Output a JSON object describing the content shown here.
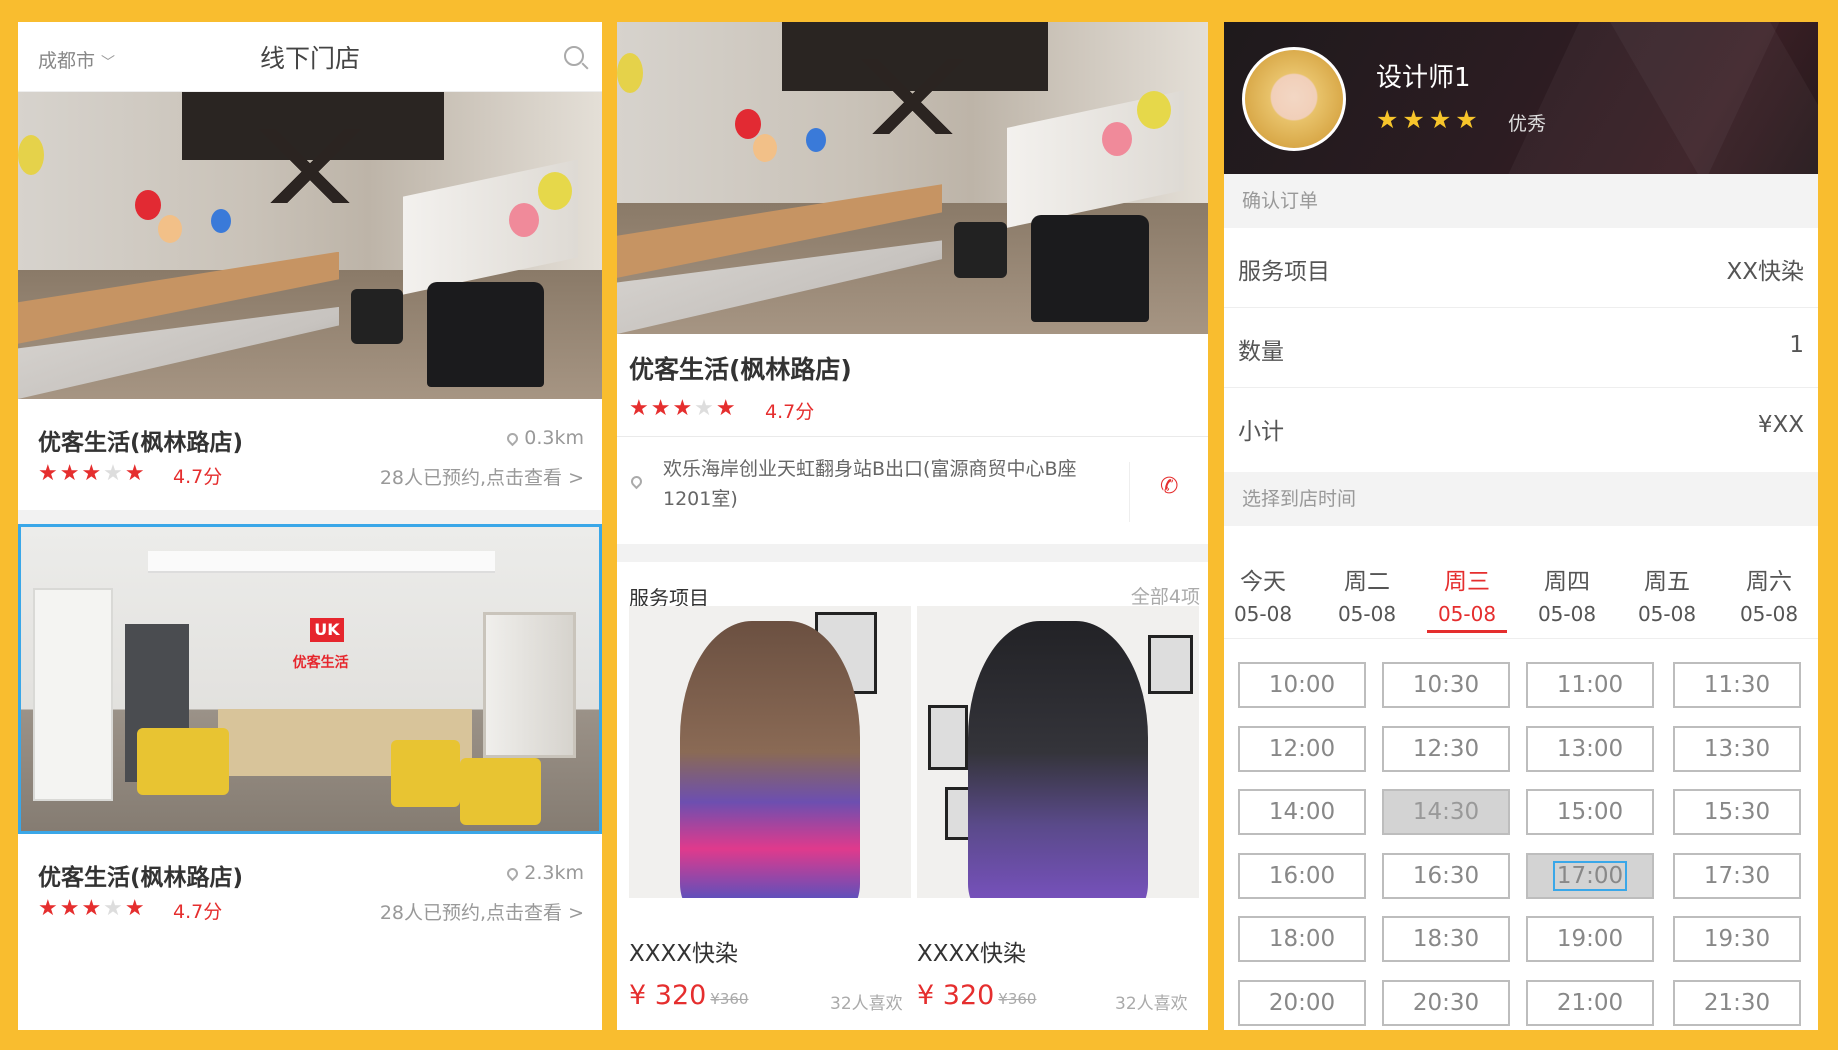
{
  "colors": {
    "background": "#f9bd2f",
    "accent_red": "#e52e2e",
    "star_gold": "#f7c52b",
    "selection_blue": "#3aa7e8"
  },
  "panel1": {
    "city": "成都市",
    "title": "线下门店",
    "stores": [
      {
        "name": "优客生活(枫林路店)",
        "distance": "0.3km",
        "score": "4.7分",
        "booked": "28人已预约,点击查看 >"
      },
      {
        "name": "优客生活(枫林路店)",
        "distance": "2.3km",
        "score": "4.7分",
        "booked": "28人已预约,点击查看 >"
      }
    ],
    "salon_logo": "UK",
    "salon_logo_text": "优客生活"
  },
  "panel2": {
    "store_name": "优客生活(枫林路店)",
    "score": "4.7分",
    "address": "欢乐海岸创业天虹翻身站B出口(富源商贸中心B座1201室)",
    "services_title": "服务项目",
    "services_all": "全部4项",
    "services": [
      {
        "name": "XXXX快染",
        "price": "¥ 320",
        "original_price": "¥360",
        "likes": "32人喜欢"
      },
      {
        "name": "XXXX快染",
        "price": "¥ 320",
        "original_price": "¥360",
        "likes": "32人喜欢"
      }
    ]
  },
  "panel3": {
    "designer_name": "设计师1",
    "rating_word": "优秀",
    "confirm_title": "确认订单",
    "rows": [
      {
        "label": "服务项目",
        "value": "XX快染"
      },
      {
        "label": "数量",
        "value": "1"
      },
      {
        "label": "小计",
        "value": "¥XX"
      }
    ],
    "select_time_title": "选择到店时间",
    "days": [
      {
        "name": "今天",
        "date": "05-08"
      },
      {
        "name": "周二",
        "date": "05-08"
      },
      {
        "name": "周三",
        "date": "05-08",
        "active": true
      },
      {
        "name": "周四",
        "date": "05-08"
      },
      {
        "name": "周五",
        "date": "05-08"
      },
      {
        "name": "周六",
        "date": "05-08"
      }
    ],
    "time_slots": [
      "10:00",
      "10:30",
      "11:00",
      "11:30",
      "12:00",
      "12:30",
      "13:00",
      "13:30",
      "14:00",
      "14:30",
      "15:00",
      "15:30",
      "16:00",
      "16:30",
      "17:00",
      "17:30",
      "18:00",
      "18:30",
      "19:00",
      "19:30",
      "20:00",
      "20:30",
      "21:00",
      "21:30"
    ],
    "disabled_slot": "14:30",
    "selected_slot": "17:00"
  }
}
